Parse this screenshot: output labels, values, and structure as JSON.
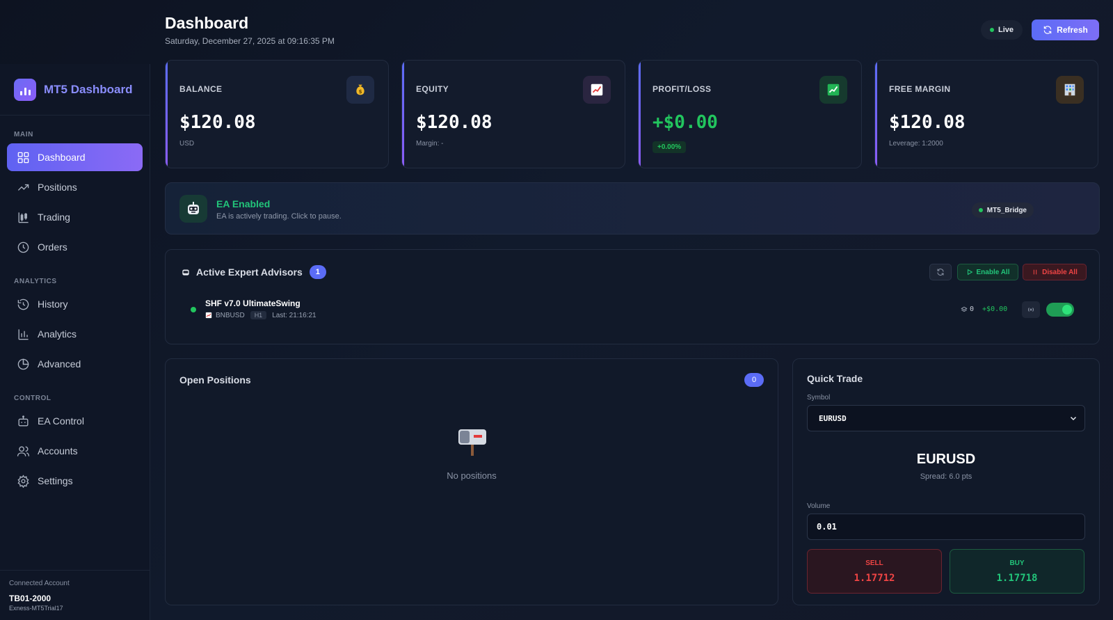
{
  "app": {
    "title": "MT5 Dashboard"
  },
  "sidebar": {
    "sections": [
      {
        "label": "MAIN",
        "items": [
          {
            "label": "Dashboard",
            "icon": "grid-icon",
            "active": true
          },
          {
            "label": "Positions",
            "icon": "trending-up-icon"
          },
          {
            "label": "Trading",
            "icon": "candlestick-icon"
          },
          {
            "label": "Orders",
            "icon": "clock-icon"
          }
        ]
      },
      {
        "label": "ANALYTICS",
        "items": [
          {
            "label": "History",
            "icon": "history-icon"
          },
          {
            "label": "Analytics",
            "icon": "bar-chart-icon"
          },
          {
            "label": "Advanced",
            "icon": "pie-chart-icon"
          }
        ]
      },
      {
        "label": "CONTROL",
        "items": [
          {
            "label": "EA Control",
            "icon": "bot-icon"
          },
          {
            "label": "Accounts",
            "icon": "users-icon"
          },
          {
            "label": "Settings",
            "icon": "gear-icon"
          }
        ]
      }
    ],
    "account": {
      "label": "Connected Account",
      "id": "TB01-2000",
      "server": "Exness-MT5Trial17"
    }
  },
  "header": {
    "title": "Dashboard",
    "date": "Saturday, December 27, 2025 at 09:16:35 PM",
    "live_label": "Live",
    "refresh_label": "Refresh"
  },
  "stats": [
    {
      "label": "BALANCE",
      "value": "$120.08",
      "sub": "USD",
      "icon": "money-bag-icon",
      "icon_bg": "#1f2a44"
    },
    {
      "label": "EQUITY",
      "value": "$120.08",
      "sub": "Margin: -",
      "icon": "chart-up-icon",
      "icon_bg": "#2a2540"
    },
    {
      "label": "PROFIT/LOSS",
      "value": "+$0.00",
      "pill": "+0.00%",
      "icon": "chart-green-icon",
      "icon_bg": "#163a2e"
    },
    {
      "label": "FREE MARGIN",
      "value": "$120.08",
      "sub": "Leverage: 1:2000",
      "icon": "building-icon",
      "icon_bg": "#3a2f22"
    }
  ],
  "ea_banner": {
    "title": "EA Enabled",
    "subtitle": "EA is actively trading. Click to pause.",
    "bridge": "MT5_Bridge"
  },
  "ea_panel": {
    "title": "Active Expert Advisors",
    "count": "1",
    "enable_all": "Enable All",
    "disable_all": "Disable All",
    "eas": [
      {
        "name": "SHF v7.0 UltimateSwing",
        "symbol": "BNBUSD",
        "timeframe": "H1",
        "last": "Last: 21:16:21",
        "positions": "0",
        "profit": "+$0.00",
        "enabled": true
      }
    ]
  },
  "positions": {
    "title": "Open Positions",
    "count": "0",
    "empty": "No positions"
  },
  "quick_trade": {
    "title": "Quick Trade",
    "symbol_label": "Symbol",
    "symbol_value": "EURUSD",
    "symbol_display": "EURUSD",
    "spread": "Spread: 6.0 pts",
    "volume_label": "Volume",
    "volume_value": "0.01",
    "sell_label": "SELL",
    "sell_price": "1.17712",
    "buy_label": "BUY",
    "buy_price": "1.17718"
  },
  "colors": {
    "accent": "#5b6cf6",
    "positive": "#22c55e",
    "negative": "#ef4444"
  }
}
